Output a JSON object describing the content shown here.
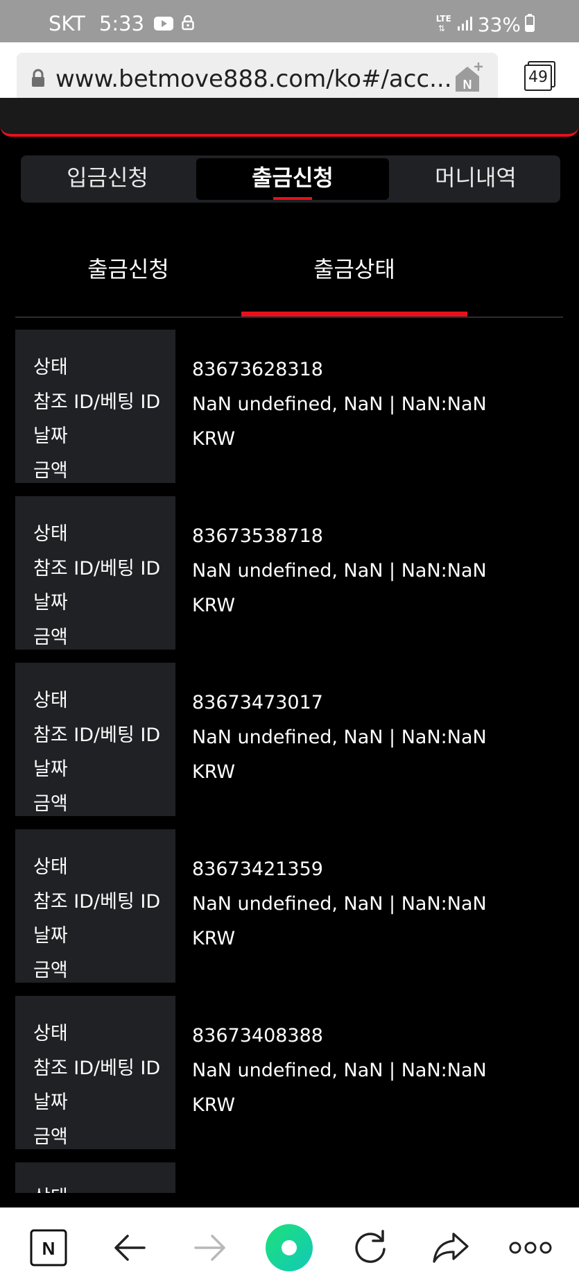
{
  "status_bar": {
    "carrier": "SKT",
    "time": "5:33",
    "network": "LTE",
    "battery": "33%"
  },
  "browser": {
    "url": "www.betmove888.com/ko#/acc...",
    "tab_count": "49"
  },
  "segments": [
    {
      "label": "입금신청",
      "active": false
    },
    {
      "label": "출금신청",
      "active": true
    },
    {
      "label": "머니내역",
      "active": false
    }
  ],
  "subtabs": [
    {
      "label": "출금신청",
      "active": false
    },
    {
      "label": "출금상태",
      "active": true
    }
  ],
  "labels": {
    "status": "상태",
    "ref_id": "참조 ID/베팅 ID",
    "date": "날짜",
    "amount": "금액"
  },
  "records": [
    {
      "ref_id": "83673628318",
      "date": "NaN undefined, NaN | NaN:NaN",
      "amount": "KRW"
    },
    {
      "ref_id": "83673538718",
      "date": "NaN undefined, NaN | NaN:NaN",
      "amount": "KRW"
    },
    {
      "ref_id": "83673473017",
      "date": "NaN undefined, NaN | NaN:NaN",
      "amount": "KRW"
    },
    {
      "ref_id": "83673421359",
      "date": "NaN undefined, NaN | NaN:NaN",
      "amount": "KRW"
    },
    {
      "ref_id": "83673408388",
      "date": "NaN undefined, NaN | NaN:NaN",
      "amount": "KRW"
    }
  ],
  "colors": {
    "accent": "#e8101a",
    "panel": "#1f2124",
    "background": "#000000",
    "statusbar": "#9b9b9b"
  },
  "icons": {
    "status_bar": [
      "youtube-icon",
      "lock-icon",
      "lte-icon",
      "signal-icon",
      "battery-icon"
    ],
    "url_bar": [
      "lock-icon",
      "naver-home-icon",
      "tabs-icon"
    ],
    "bottom_nav": [
      "naver-icon",
      "back-arrow-icon",
      "forward-arrow-icon",
      "green-dot-icon",
      "refresh-icon",
      "share-icon",
      "more-icon"
    ]
  }
}
